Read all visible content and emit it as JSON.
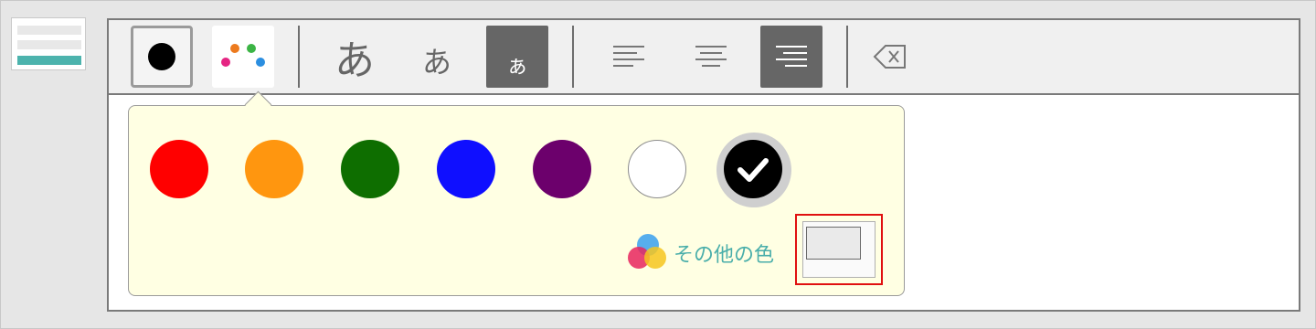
{
  "thumbnail": {
    "label": ""
  },
  "toolbar": {
    "text_color": "#000000",
    "palette_dots": [
      "#ec5a1e",
      "#3cb445",
      "#e52583",
      "#2b8ee0"
    ],
    "font_large": "あ",
    "font_medium": "あ",
    "font_small": "ぁ",
    "active_font": "small",
    "active_alignment": "right",
    "delete_icon": "backspace-icon"
  },
  "palette": {
    "swatches": [
      {
        "name": "red",
        "color": "#ff0000",
        "selected": false
      },
      {
        "name": "orange",
        "color": "#ff960f",
        "selected": false
      },
      {
        "name": "green",
        "color": "#0e6e00",
        "selected": false
      },
      {
        "name": "blue",
        "color": "#0f0fff",
        "selected": false
      },
      {
        "name": "purple",
        "color": "#6c006c",
        "selected": false
      },
      {
        "name": "white",
        "color": "#ffffff",
        "selected": false
      },
      {
        "name": "black",
        "color": "#000000",
        "selected": true
      }
    ],
    "more_colors_label": "その他の色",
    "custom_color": "#eaeaea"
  }
}
